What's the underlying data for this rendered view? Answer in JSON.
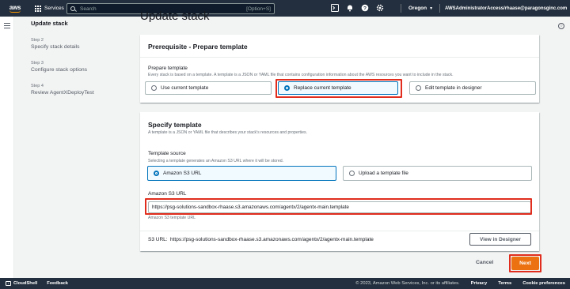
{
  "topnav": {
    "logo": "aws",
    "services_label": "Services",
    "search_placeholder": "Search",
    "search_shortcut": "[Option+S]",
    "region": "Oregon",
    "account": "AWSAdministratorAccess/rhaase@paragonsginc.com",
    "icons": [
      "terminal-icon",
      "bell-icon",
      "help-icon",
      "settings-icon"
    ]
  },
  "sidebar": {
    "title": "Update stack",
    "steps": [
      {
        "num": "Step 2",
        "label": "Specify stack details"
      },
      {
        "num": "Step 3",
        "label": "Configure stack options"
      },
      {
        "num": "Step 4",
        "label": "Review AgentXDeployTest"
      }
    ]
  },
  "page": {
    "title": "Update stack"
  },
  "prerequisite": {
    "heading": "Prerequisite - Prepare template",
    "label": "Prepare template",
    "description": "Every stack is based on a template. A template is a JSON or YAML file that contains configuration information about the AWS resources you want to include in the stack.",
    "options": [
      "Use current template",
      "Replace current template",
      "Edit template in designer"
    ],
    "selected": "Replace current template"
  },
  "specify": {
    "heading": "Specify template",
    "description": "A template is a JSON or YAML file that describes your stack's resources and properties.",
    "source_label": "Template source",
    "source_description": "Selecting a template generates an Amazon S3 URL where it will be stored.",
    "source_options": [
      "Amazon S3 URL",
      "Upload a template file"
    ],
    "source_selected": "Amazon S3 URL",
    "url_label": "Amazon S3 URL",
    "url_value": "https://psg-solutions-sandbox-rhaase.s3.amazonaws.com/agentx/2/agentx-main.template",
    "url_hint": "Amazon S3 template URL",
    "s3_url_label": "S3 URL:",
    "s3_url_value": "https://psg-solutions-sandbox-rhaase.s3.amazonaws.com/agentx/2/agentx-main.template",
    "designer_button": "View in Designer"
  },
  "actions": {
    "cancel": "Cancel",
    "next": "Next"
  },
  "footer": {
    "cloudshell": "CloudShell",
    "feedback": "Feedback",
    "copyright": "© 2023, Amazon Web Services, Inc. or its affiliates.",
    "privacy": "Privacy",
    "terms": "Terms",
    "cookies": "Cookie preferences"
  },
  "colors": {
    "nav_bg": "#232f3e",
    "primary": "#ec7211",
    "selected": "#0073bb",
    "highlight": "#e02d1d"
  }
}
